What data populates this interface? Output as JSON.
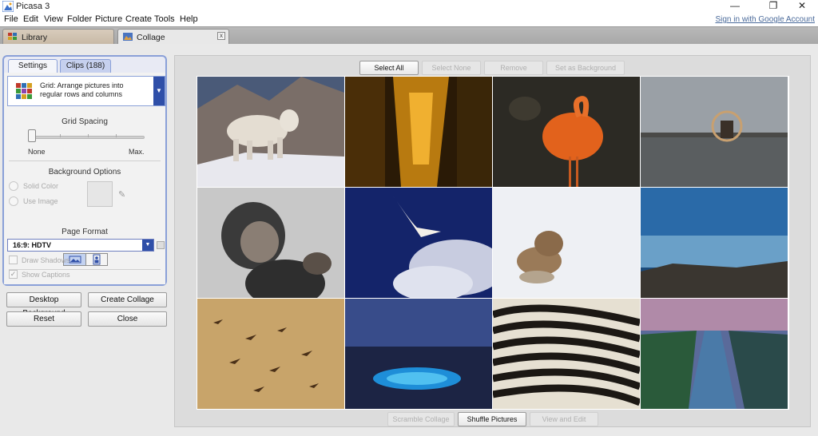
{
  "window": {
    "title": "Picasa 3",
    "min_glyph": "—",
    "max_glyph": "❐",
    "close_glyph": "✕"
  },
  "menu": {
    "items": [
      "File",
      "Edit",
      "View",
      "Folder",
      "Picture",
      "Create",
      "Tools",
      "Help"
    ],
    "signin": "Sign in with Google Account"
  },
  "tabs": {
    "library": "Library",
    "collage": "Collage",
    "close_glyph": "x"
  },
  "panel": {
    "tab_settings": "Settings",
    "tab_clips": "Clips (188)",
    "layout_text": "Grid:  Arrange pictures into regular rows and columns",
    "grid_spacing": "Grid Spacing",
    "slider_min": "None",
    "slider_max": "Max.",
    "slider_value": 0,
    "background_options": "Background Options",
    "solid_color": "Solid Color",
    "use_image": "Use Image",
    "page_format": "Page Format",
    "format_value": "16:9: HDTV",
    "draw_shadows": "Draw Shadows",
    "show_captions": "Show Captions"
  },
  "buttons": {
    "desktop_background": "Desktop Background",
    "create_collage": "Create Collage",
    "reset": "Reset",
    "close": "Close"
  },
  "toolbar_top": {
    "select_all": "Select All",
    "select_none": "Select None",
    "remove": "Remove",
    "set_background": "Set as Background"
  },
  "toolbar_bottom": {
    "scramble": "Scramble Collage",
    "shuffle": "Shuffle Pictures",
    "view_edit": "View and Edit"
  },
  "colors": {
    "accent": "#2f4fa8",
    "panel_border": "#8aa0d8"
  }
}
